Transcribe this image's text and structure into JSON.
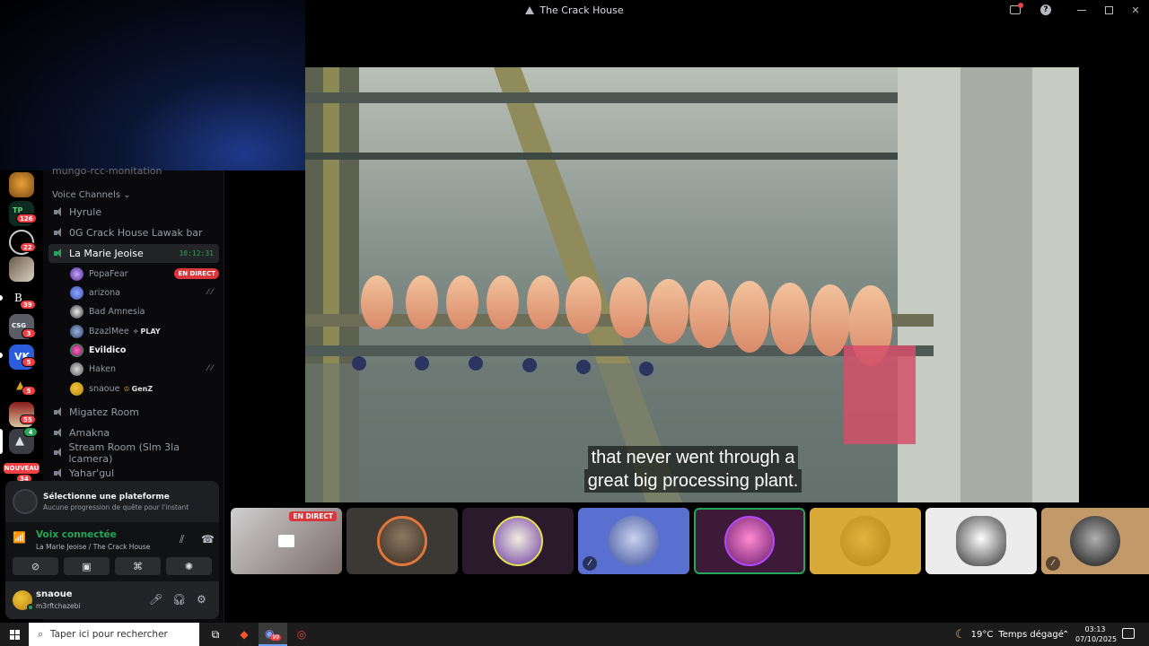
{
  "window": {
    "title": "The Crack House"
  },
  "servers": {
    "badges": [
      "126",
      "22",
      "39",
      "3",
      "5",
      "5",
      "55",
      "4"
    ],
    "nouveau_label": "NOUVEAU",
    "nouveau_badge": "34"
  },
  "sidebar": {
    "cut_channel": "mungo-rcc-monitation",
    "category": "Voice Channels",
    "channels": [
      {
        "name": "Hyrule"
      },
      {
        "name": "0G Crack House Lawak bar"
      },
      {
        "name": "La Marie Jeoise",
        "time": "10:12:31"
      },
      {
        "name": "Migatez Room"
      },
      {
        "name": "Amakna"
      },
      {
        "name": "Stream Room (Slm 3la lcamera)"
      },
      {
        "name": "Yahar'gul"
      }
    ],
    "members": [
      {
        "name": "PopaFear",
        "badge": "EN DIRECT"
      },
      {
        "name": "arizona"
      },
      {
        "name": "Bad Amnesia"
      },
      {
        "name": "BzazlMee",
        "tag": "PLAY"
      },
      {
        "name": "Evildico"
      },
      {
        "name": "Haken"
      },
      {
        "name": "snaoue",
        "tag": "GenZ"
      }
    ]
  },
  "panel": {
    "quest_title": "Sélectionne une plateforme",
    "quest_sub": "Aucune progression de quête pour l'instant",
    "voice_title": "Voix connectée",
    "voice_sub": "La Marie Jeoise / The Crack House",
    "user_name": "snaoue",
    "user_status": "m3rftchazebi"
  },
  "video": {
    "subtitle_line1": "that never went through a",
    "subtitle_line2": "great big processing plant."
  },
  "tiles": {
    "live_label": "EN DIRECT"
  },
  "taskbar": {
    "search_placeholder": "Taper ici pour rechercher",
    "temperature": "19°C",
    "weather": "Temps dégagé",
    "time": "03:13",
    "date": "07/10/2025",
    "discord_badge": "99"
  },
  "colors": {
    "accent_green": "#23a55a",
    "live_red": "#da373c",
    "badge_red": "#f23f43"
  }
}
